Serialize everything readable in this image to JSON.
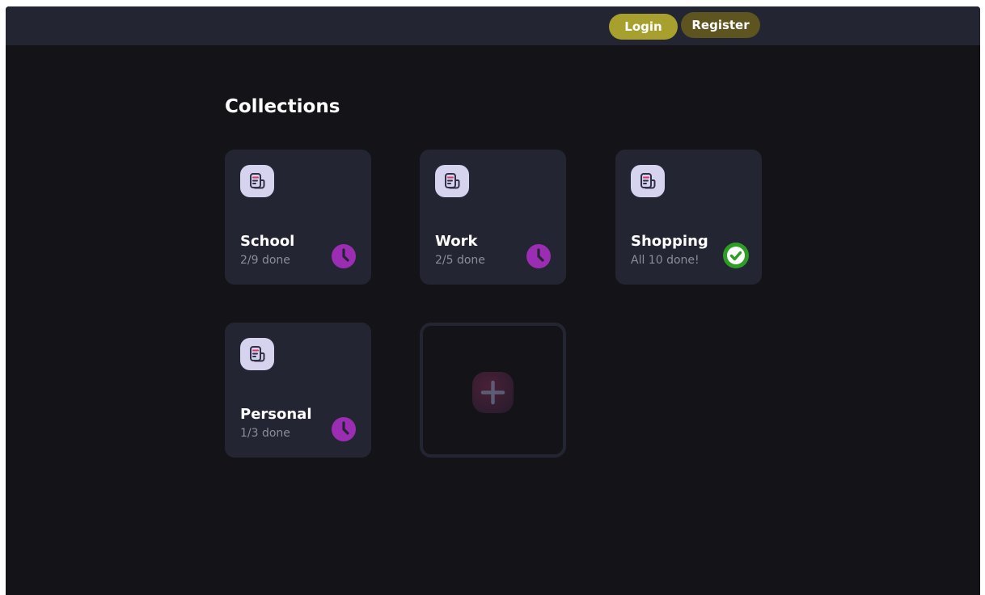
{
  "header": {
    "login_label": "Login",
    "register_label": "Register"
  },
  "main": {
    "title": "Collections",
    "collections": [
      {
        "name": "School",
        "progress": "2/9 done",
        "status": "pending",
        "icon": "clock-icon"
      },
      {
        "name": "Work",
        "progress": "2/5 done",
        "status": "pending",
        "icon": "clock-icon"
      },
      {
        "name": "Shopping",
        "progress": "All 10 done!",
        "status": "done",
        "icon": "check-circle-icon"
      },
      {
        "name": "Personal",
        "progress": "1/3 done",
        "status": "pending",
        "icon": "clock-icon"
      }
    ],
    "add_card_icon": "plus-icon"
  },
  "colors": {
    "background": "#141418",
    "surface": "#232533",
    "login_button": "#a7a02f",
    "register_button": "#5d5420",
    "pending_status": "#9b2db2",
    "done_status": "#2e9d24",
    "collection_icon_bg": "#d6d3ee"
  }
}
